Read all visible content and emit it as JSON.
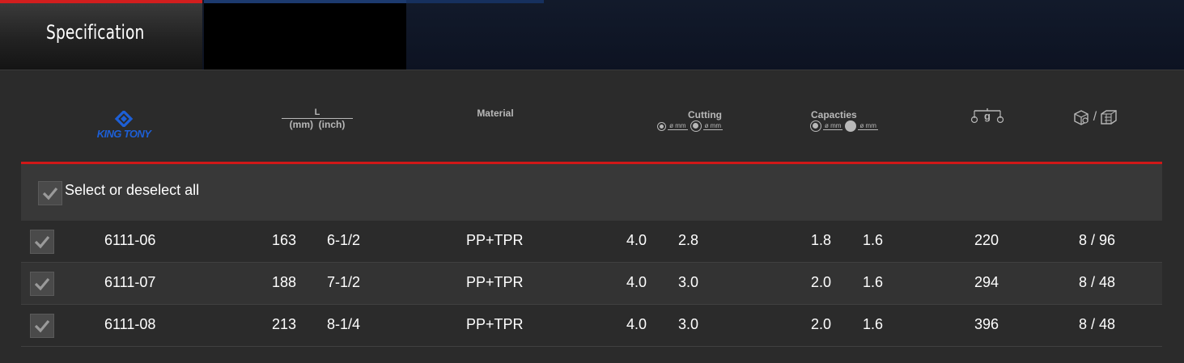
{
  "tabs": {
    "active_label": "Specification"
  },
  "header": {
    "brand_logo": "KING TONY",
    "length": {
      "label": "L",
      "unit_mm": "(mm)",
      "unit_inch": "(inch)"
    },
    "material": "Material",
    "cutting": {
      "label": "Cutting",
      "mm1": "ø mm",
      "mm2": "ø mm"
    },
    "capacities": {
      "label": "Capacties",
      "mm1": "ø mm",
      "mm2": "ø mm"
    },
    "weight_unit": "g",
    "packing_separator": "/"
  },
  "select_all_label": "Select or deselect all",
  "rows": [
    {
      "code": "6111-06",
      "mm": "163",
      "inch": "6-1/2",
      "material": "PP+TPR",
      "cut1": "4.0",
      "cut2": "2.8",
      "cap1": "1.8",
      "cap2": "1.6",
      "weight": "220",
      "pack": "8 / 96"
    },
    {
      "code": "6111-07",
      "mm": "188",
      "inch": "7-1/2",
      "material": "PP+TPR",
      "cut1": "4.0",
      "cut2": "3.0",
      "cap1": "2.0",
      "cap2": "1.6",
      "weight": "294",
      "pack": "8 / 48"
    },
    {
      "code": "6111-08",
      "mm": "213",
      "inch": "8-1/4",
      "material": "PP+TPR",
      "cut1": "4.0",
      "cut2": "3.0",
      "cap1": "2.0",
      "cap2": "1.6",
      "weight": "396",
      "pack": "8 / 48"
    }
  ],
  "colors": {
    "accent_red": "#d01818",
    "brand_blue": "#1d5fd6",
    "panel": "#2b2b2b"
  }
}
